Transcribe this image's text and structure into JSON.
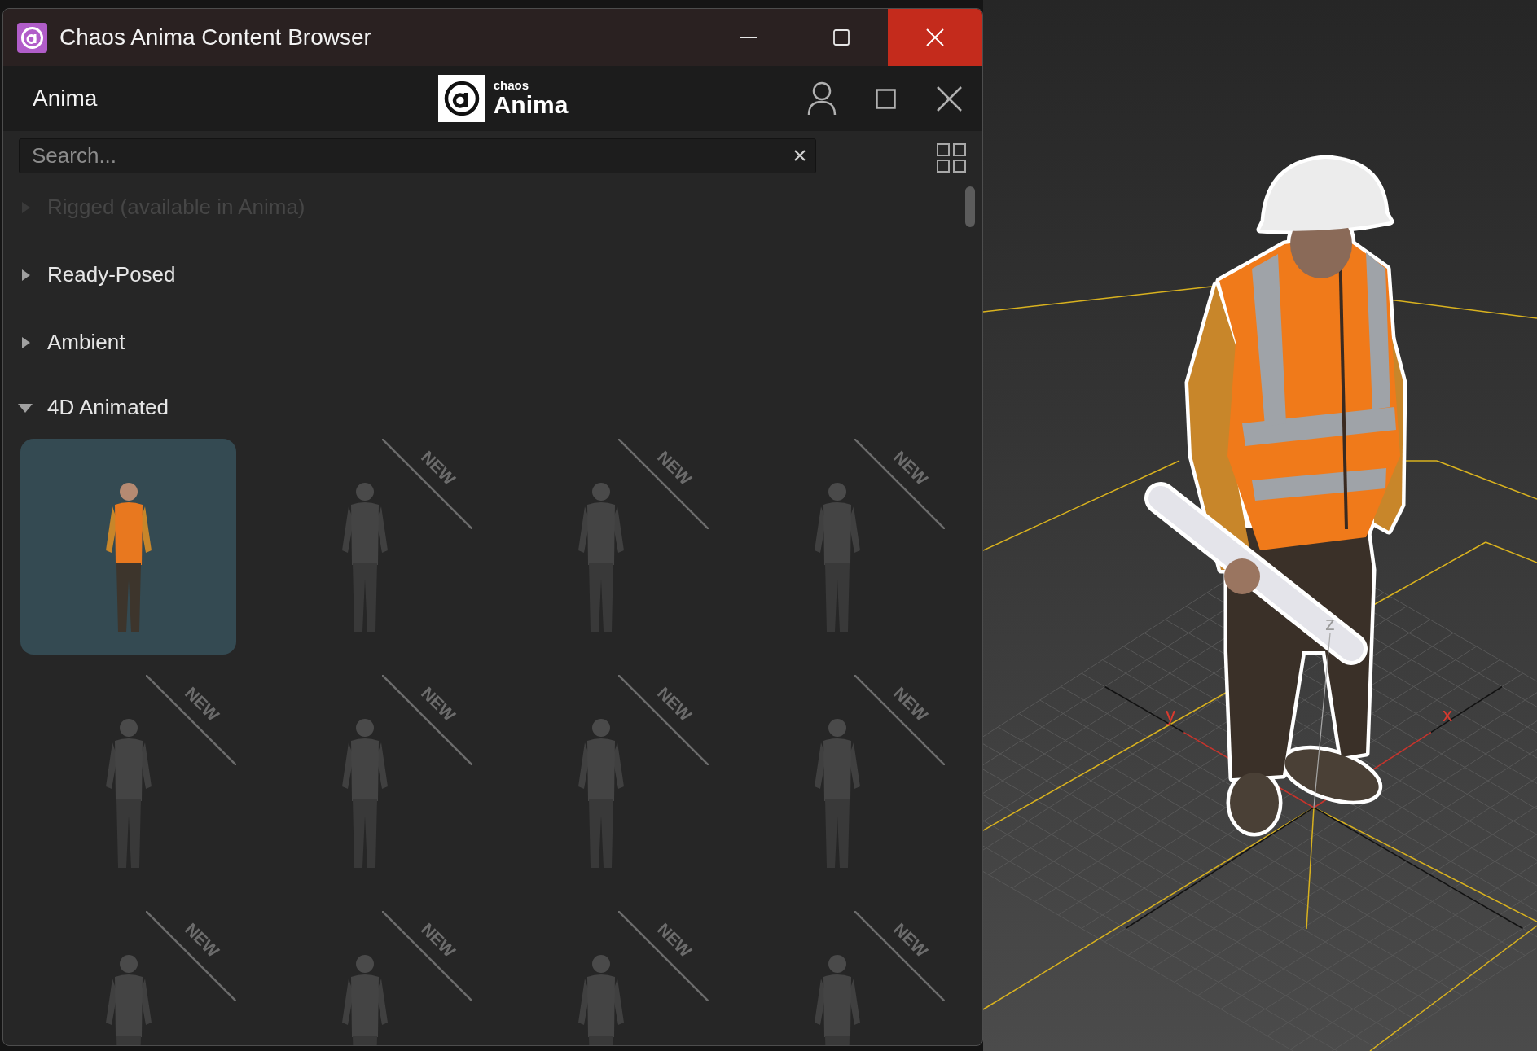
{
  "window": {
    "title": "Chaos Anima Content Browser"
  },
  "header": {
    "title": "Anima",
    "logo": {
      "small_text": "chaos",
      "large_text": "Anima"
    }
  },
  "search": {
    "placeholder": "Search..."
  },
  "categories": [
    {
      "label": "Rigged (available in Anima)",
      "disabled": true,
      "expanded": false
    },
    {
      "label": "Ready-Posed",
      "disabled": false,
      "expanded": false
    },
    {
      "label": "Ambient",
      "disabled": false,
      "expanded": false
    },
    {
      "label": "4D Animated",
      "disabled": false,
      "expanded": true,
      "items": [
        {
          "selected": true
        },
        {
          "selected": false,
          "badge": "NEW"
        },
        {
          "selected": false,
          "badge": "NEW"
        },
        {
          "selected": false,
          "badge": "NEW"
        },
        {
          "selected": false,
          "badge": "NEW"
        },
        {
          "selected": false,
          "badge": "NEW"
        },
        {
          "selected": false,
          "badge": "NEW"
        },
        {
          "selected": false,
          "badge": "NEW"
        },
        {
          "selected": false,
          "badge": "NEW"
        },
        {
          "selected": false,
          "badge": "NEW"
        },
        {
          "selected": false,
          "badge": "NEW"
        },
        {
          "selected": false,
          "badge": "NEW"
        }
      ]
    }
  ],
  "viewport": {
    "axis_labels": [
      {
        "kind": "y",
        "text": "y"
      },
      {
        "kind": "x",
        "text": "x"
      },
      {
        "kind": "z",
        "text": "z"
      }
    ]
  }
}
